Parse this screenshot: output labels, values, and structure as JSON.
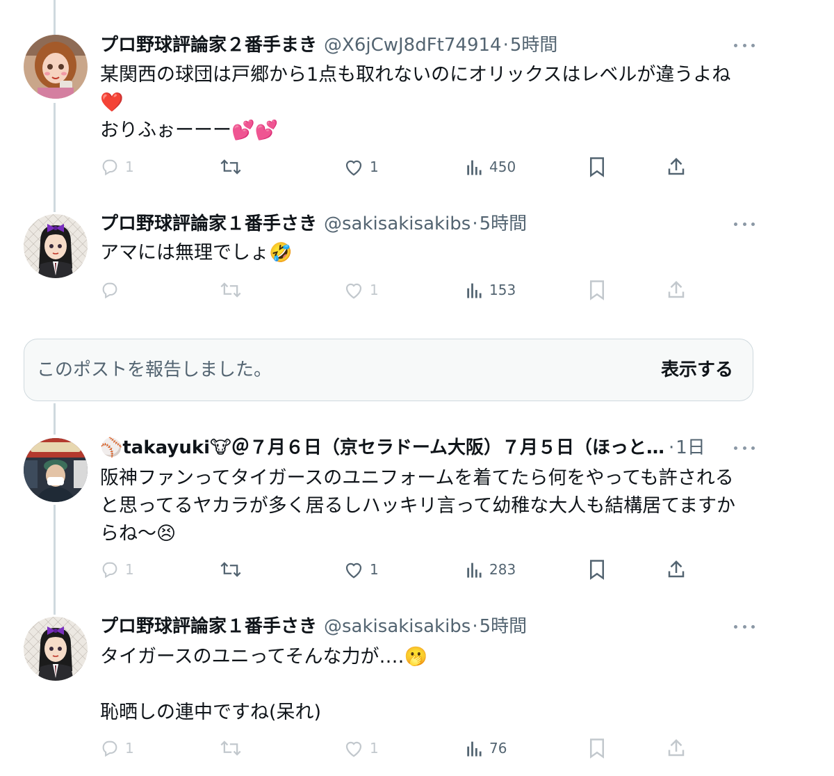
{
  "posts": [
    {
      "name": "プロ野球評論家２番手まき",
      "handle": "@X6jCwJ8dFt74914",
      "sep": "·",
      "time": "5時間",
      "avatar_icon": "anime-girl-avatar",
      "text": "某関西の球団は戸郷から1点も取れないのにオリックスはレベルが違うよね\n❤️\nおりふぉーーー💕💕",
      "stats": {
        "replies": "1",
        "likes": "1",
        "views": "450"
      }
    },
    {
      "name": "プロ野球評論家１番手さき",
      "handle": "@sakisakisakibs",
      "sep": "·",
      "time": "5時間",
      "avatar_icon": "girl-with-bow-avatar",
      "text": "アマには無理でしょ🤣",
      "stats": {
        "replies": "",
        "likes": "1",
        "views": "153"
      }
    },
    {
      "name": "⚾takayuki🐮＠７月６日（京セラドーム大阪）７月５日（ほっと…",
      "handle": "",
      "sep": "·",
      "time": "1日",
      "avatar_icon": "buffaloes-fan-avatar",
      "text": "阪神ファンってタイガースのユニフォームを着てたら何をやっても許されると思ってるヤカラが多く居るしハッキリ言って幼稚な大人も結構居てますからね〜😣",
      "stats": {
        "replies": "1",
        "likes": "1",
        "views": "283"
      }
    },
    {
      "name": "プロ野球評論家１番手さき",
      "handle": "@sakisakisakibs",
      "sep": "·",
      "time": "5時間",
      "avatar_icon": "girl-with-bow-avatar",
      "text": "タイガースのユニってそんな力が‥‥🫢\n\n恥晒しの連中ですね(呆れ)",
      "stats": {
        "replies": "1",
        "likes": "1",
        "views": "76"
      }
    }
  ],
  "reported_notice": {
    "message": "このポストを報告しました。",
    "show_label": "表示する"
  },
  "colors": {
    "text_primary": "#0f1419",
    "text_secondary": "#536471",
    "thread_line": "#cfd9de",
    "notice_bg": "#f7f9f9"
  }
}
